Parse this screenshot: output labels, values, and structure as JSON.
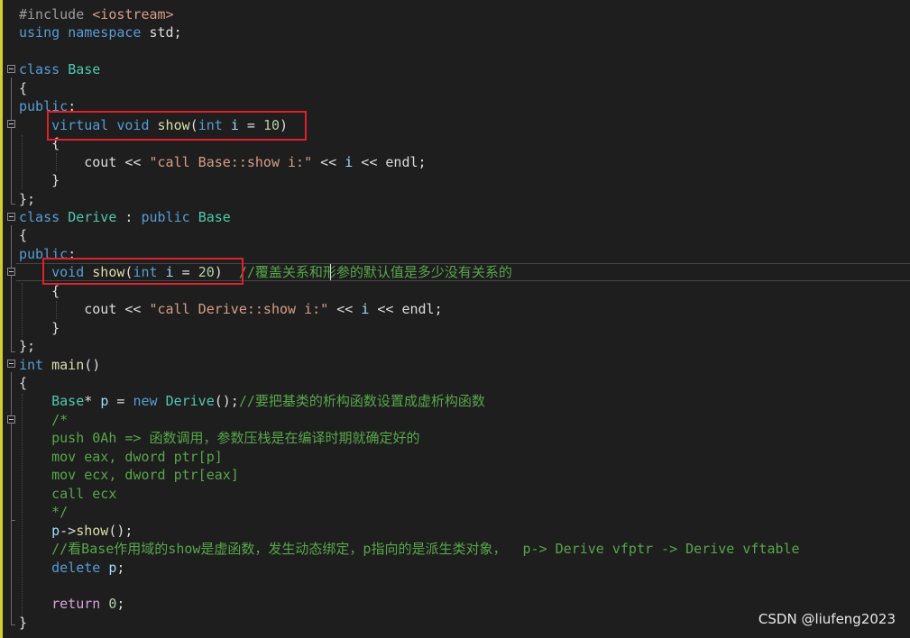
{
  "editor": {
    "lines": [
      {
        "tokens": [
          {
            "t": "#include",
            "c": "pp"
          },
          {
            "t": " ",
            "c": "txt"
          },
          {
            "t": "<iostream>",
            "c": "str"
          }
        ]
      },
      {
        "tokens": [
          {
            "t": "using",
            "c": "kw"
          },
          {
            "t": " ",
            "c": "txt"
          },
          {
            "t": "namespace",
            "c": "kw"
          },
          {
            "t": " std;",
            "c": "txt"
          }
        ]
      },
      {
        "tokens": []
      },
      {
        "tokens": [
          {
            "t": "class",
            "c": "kw"
          },
          {
            "t": " ",
            "c": "txt"
          },
          {
            "t": "Base",
            "c": "ty"
          }
        ]
      },
      {
        "tokens": [
          {
            "t": "{",
            "c": "txt"
          }
        ]
      },
      {
        "tokens": [
          {
            "t": "public",
            "c": "kw"
          },
          {
            "t": ":",
            "c": "txt"
          }
        ]
      },
      {
        "tokens": [
          {
            "t": "    ",
            "c": "txt"
          },
          {
            "t": "virtual",
            "c": "kw"
          },
          {
            "t": " ",
            "c": "txt"
          },
          {
            "t": "void",
            "c": "kw"
          },
          {
            "t": " ",
            "c": "txt"
          },
          {
            "t": "show",
            "c": "fn"
          },
          {
            "t": "(",
            "c": "txt"
          },
          {
            "t": "int",
            "c": "kw"
          },
          {
            "t": " ",
            "c": "txt"
          },
          {
            "t": "i",
            "c": "vr"
          },
          {
            "t": " = ",
            "c": "txt"
          },
          {
            "t": "10",
            "c": "num"
          },
          {
            "t": ")",
            "c": "txt"
          }
        ]
      },
      {
        "tokens": [
          {
            "t": "    {",
            "c": "txt"
          }
        ]
      },
      {
        "tokens": [
          {
            "t": "        cout << ",
            "c": "txt"
          },
          {
            "t": "\"call Base::show i:\"",
            "c": "str"
          },
          {
            "t": " << ",
            "c": "txt"
          },
          {
            "t": "i",
            "c": "vr"
          },
          {
            "t": " << endl;",
            "c": "txt"
          }
        ]
      },
      {
        "tokens": [
          {
            "t": "    }",
            "c": "txt"
          }
        ]
      },
      {
        "tokens": [
          {
            "t": "};",
            "c": "txt"
          }
        ]
      },
      {
        "tokens": [
          {
            "t": "class",
            "c": "kw"
          },
          {
            "t": " ",
            "c": "txt"
          },
          {
            "t": "Derive",
            "c": "ty"
          },
          {
            "t": " : ",
            "c": "txt"
          },
          {
            "t": "public",
            "c": "kw"
          },
          {
            "t": " ",
            "c": "txt"
          },
          {
            "t": "Base",
            "c": "ty"
          }
        ]
      },
      {
        "tokens": [
          {
            "t": "{",
            "c": "txt"
          }
        ]
      },
      {
        "tokens": [
          {
            "t": "public",
            "c": "kw"
          },
          {
            "t": ":",
            "c": "txt"
          }
        ]
      },
      {
        "tokens": [
          {
            "t": "    ",
            "c": "txt"
          },
          {
            "t": "void",
            "c": "kw"
          },
          {
            "t": " ",
            "c": "txt"
          },
          {
            "t": "show",
            "c": "fn"
          },
          {
            "t": "(",
            "c": "txt"
          },
          {
            "t": "int",
            "c": "kw"
          },
          {
            "t": " ",
            "c": "txt"
          },
          {
            "t": "i",
            "c": "vr"
          },
          {
            "t": " = ",
            "c": "txt"
          },
          {
            "t": "20",
            "c": "num"
          },
          {
            "t": ")  ",
            "c": "txt"
          },
          {
            "t": "//覆盖关系和形参的默认值是多少没有关系的",
            "c": "cm"
          }
        ]
      },
      {
        "tokens": [
          {
            "t": "    {",
            "c": "txt"
          }
        ]
      },
      {
        "tokens": [
          {
            "t": "        cout << ",
            "c": "txt"
          },
          {
            "t": "\"call Derive::show i:\"",
            "c": "str"
          },
          {
            "t": " << ",
            "c": "txt"
          },
          {
            "t": "i",
            "c": "vr"
          },
          {
            "t": " << endl;",
            "c": "txt"
          }
        ]
      },
      {
        "tokens": [
          {
            "t": "    }",
            "c": "txt"
          }
        ]
      },
      {
        "tokens": [
          {
            "t": "};",
            "c": "txt"
          }
        ]
      },
      {
        "tokens": [
          {
            "t": "int",
            "c": "kw"
          },
          {
            "t": " ",
            "c": "txt"
          },
          {
            "t": "main",
            "c": "fn"
          },
          {
            "t": "()",
            "c": "txt"
          }
        ]
      },
      {
        "tokens": [
          {
            "t": "{",
            "c": "txt"
          }
        ]
      },
      {
        "tokens": [
          {
            "t": "    ",
            "c": "txt"
          },
          {
            "t": "Base",
            "c": "ty"
          },
          {
            "t": "* ",
            "c": "txt"
          },
          {
            "t": "p",
            "c": "vr"
          },
          {
            "t": " = ",
            "c": "txt"
          },
          {
            "t": "new",
            "c": "kw"
          },
          {
            "t": " ",
            "c": "txt"
          },
          {
            "t": "Derive",
            "c": "ty"
          },
          {
            "t": "();",
            "c": "txt"
          },
          {
            "t": "//要把基类的析构函数设置成虚析构函数",
            "c": "cm"
          }
        ]
      },
      {
        "tokens": [
          {
            "t": "    /*",
            "c": "cm"
          }
        ]
      },
      {
        "tokens": [
          {
            "t": "    push 0Ah => 函数调用，参数压栈是在编译时期就确定好的",
            "c": "cm"
          }
        ]
      },
      {
        "tokens": [
          {
            "t": "    mov eax, dword ptr[p]",
            "c": "cm"
          }
        ]
      },
      {
        "tokens": [
          {
            "t": "    mov ecx, dword ptr[eax]",
            "c": "cm"
          }
        ]
      },
      {
        "tokens": [
          {
            "t": "    call ecx",
            "c": "cm"
          }
        ]
      },
      {
        "tokens": [
          {
            "t": "    */",
            "c": "cm"
          }
        ]
      },
      {
        "tokens": [
          {
            "t": "    ",
            "c": "txt"
          },
          {
            "t": "p",
            "c": "vr"
          },
          {
            "t": "->",
            "c": "txt"
          },
          {
            "t": "show",
            "c": "fn"
          },
          {
            "t": "();",
            "c": "txt"
          }
        ]
      },
      {
        "tokens": [
          {
            "t": "    //看Base作用域的show是虚函数，发生动态绑定，p指向的是派生类对象，  p-> Derive vfptr -> Derive vftable",
            "c": "cm"
          }
        ]
      },
      {
        "tokens": [
          {
            "t": "    ",
            "c": "txt"
          },
          {
            "t": "delete",
            "c": "kw"
          },
          {
            "t": " ",
            "c": "txt"
          },
          {
            "t": "p",
            "c": "vr"
          },
          {
            "t": ";",
            "c": "txt"
          }
        ]
      },
      {
        "tokens": []
      },
      {
        "tokens": [
          {
            "t": "    ",
            "c": "txt"
          },
          {
            "t": "return",
            "c": "ctl"
          },
          {
            "t": " ",
            "c": "txt"
          },
          {
            "t": "0",
            "c": "num"
          },
          {
            "t": ";",
            "c": "txt"
          }
        ]
      },
      {
        "tokens": [
          {
            "t": "}",
            "c": "txt"
          }
        ]
      }
    ]
  },
  "watermark": "CSDN @liufeng2023",
  "colors": {
    "background": "#1e1e1e",
    "highlight_box": "#e0202a",
    "change_bar": "#d4cf2e"
  }
}
